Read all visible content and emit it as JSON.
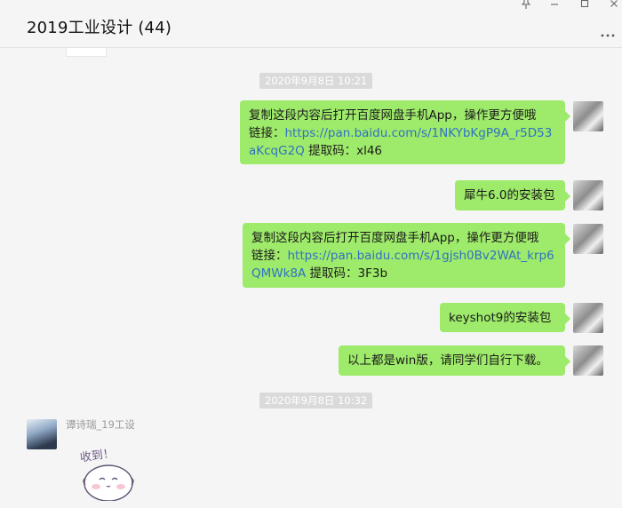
{
  "header": {
    "title": "2019工业设计 (44)",
    "more_icon": "more-icon"
  },
  "window_controls": [
    "pin-icon",
    "minimize-icon",
    "maximize-icon",
    "close-icon"
  ],
  "messages": [
    {
      "type": "timestamp",
      "text": "2020年9月8日 10:21"
    },
    {
      "type": "outgoing",
      "line1": "复制这段内容后打开百度网盘手机App，操作更方便哦",
      "label": "链接：",
      "link1": "https://pan.baidu.com/s/1NKYbKgP9A_r5D53",
      "link2": "aKcqG2Q",
      "code": " 提取码：xl46"
    },
    {
      "type": "outgoing",
      "text": "犀牛6.0的安装包"
    },
    {
      "type": "outgoing",
      "line1": "复制这段内容后打开百度网盘手机App，操作更方便哦",
      "label": "链接：",
      "link1": "https://pan.baidu.com/s/1gjsh0Bv2WAt_krp6",
      "link2": "QMWk8A",
      "code": " 提取码：3F3b"
    },
    {
      "type": "outgoing",
      "text": "keyshot9的安装包"
    },
    {
      "type": "outgoing",
      "text": "以上都是win版，请同学们自行下载。"
    },
    {
      "type": "timestamp",
      "text": "2020年9月8日 10:32"
    },
    {
      "type": "incoming",
      "sender": "谭诗瑞_19工设",
      "sticker_text": "收到！"
    }
  ],
  "colors": {
    "bubble_green": "#9eea6a",
    "link_blue": "#2f72c4",
    "background": "#f5f5f5",
    "timestamp_bg": "#dadada"
  }
}
